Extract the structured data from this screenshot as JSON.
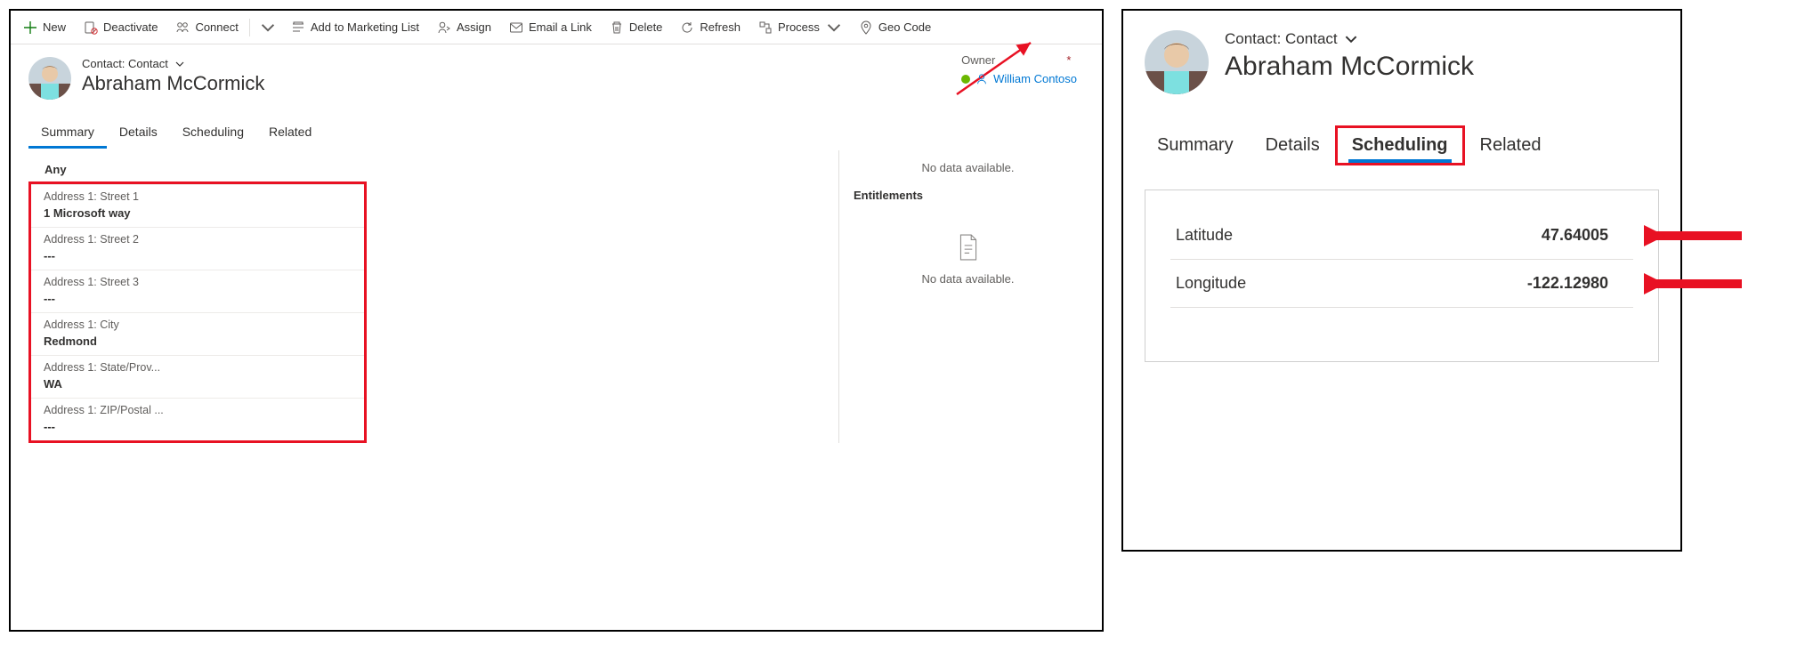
{
  "commands": {
    "new": "New",
    "deactivate": "Deactivate",
    "connect": "Connect",
    "add_marketing": "Add to Marketing List",
    "assign": "Assign",
    "email_link": "Email a Link",
    "delete": "Delete",
    "refresh": "Refresh",
    "process": "Process",
    "geo_code": "Geo Code"
  },
  "header": {
    "entity_label": "Contact: Contact",
    "record_name": "Abraham McCormick",
    "owner_label": "Owner",
    "owner_required": "*",
    "owner_value": "William Contoso"
  },
  "tabs_left": {
    "summary": "Summary",
    "details": "Details",
    "scheduling": "Scheduling",
    "related": "Related"
  },
  "tabs_right": {
    "summary": "Summary",
    "details": "Details",
    "scheduling": "Scheduling",
    "related": "Related"
  },
  "address": {
    "section": "Any",
    "fields": [
      {
        "label": "Address 1: Street 1",
        "value": "1 Microsoft way"
      },
      {
        "label": "Address 1: Street 2",
        "value": "---"
      },
      {
        "label": "Address 1: Street 3",
        "value": "---"
      },
      {
        "label": "Address 1: City",
        "value": "Redmond"
      },
      {
        "label": "Address 1: State/Prov...",
        "value": "WA"
      },
      {
        "label": "Address 1: ZIP/Postal ...",
        "value": "---"
      }
    ]
  },
  "side": {
    "no_data": "No data available.",
    "entitlements": "Entitlements"
  },
  "scheduling": {
    "latitude_label": "Latitude",
    "latitude_value": "47.64005",
    "longitude_label": "Longitude",
    "longitude_value": "-122.12980"
  }
}
